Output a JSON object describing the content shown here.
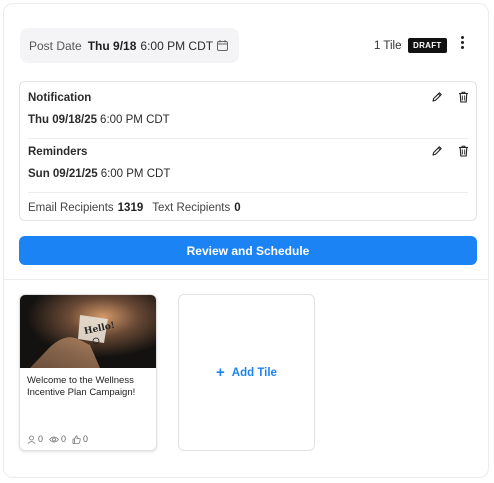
{
  "header": {
    "post_date_label": "Post Date",
    "post_date_day": "Thu 9/18",
    "post_date_time": "6:00 PM CDT",
    "tile_count": "1 Tile",
    "status_badge": "DRAFT"
  },
  "schedule": {
    "notification": {
      "title": "Notification",
      "date": "Thu 09/18/25",
      "time": "6:00 PM CDT"
    },
    "reminders": {
      "title": "Reminders",
      "date": "Sun 09/21/25",
      "time": "6:00 PM CDT"
    },
    "recipients": {
      "email_label": "Email Recipients",
      "email_count": "1319",
      "text_label": "Text Recipients",
      "text_count": "0"
    }
  },
  "review_button_label": "Review and Schedule",
  "tiles": [
    {
      "title": "Welcome to the Wellness Incentive Plan Campaign!",
      "image_text": "Hello!",
      "stats": {
        "users": "0",
        "views": "0",
        "likes": "0"
      }
    }
  ],
  "add_tile_label": "Add Tile",
  "colors": {
    "accent": "#1b83f3",
    "badge_bg": "#111111"
  },
  "icons": [
    "calendar-icon",
    "kebab-menu-icon",
    "edit-icon",
    "trash-icon",
    "user-icon",
    "eye-icon",
    "thumbs-up-icon",
    "plus-icon"
  ]
}
